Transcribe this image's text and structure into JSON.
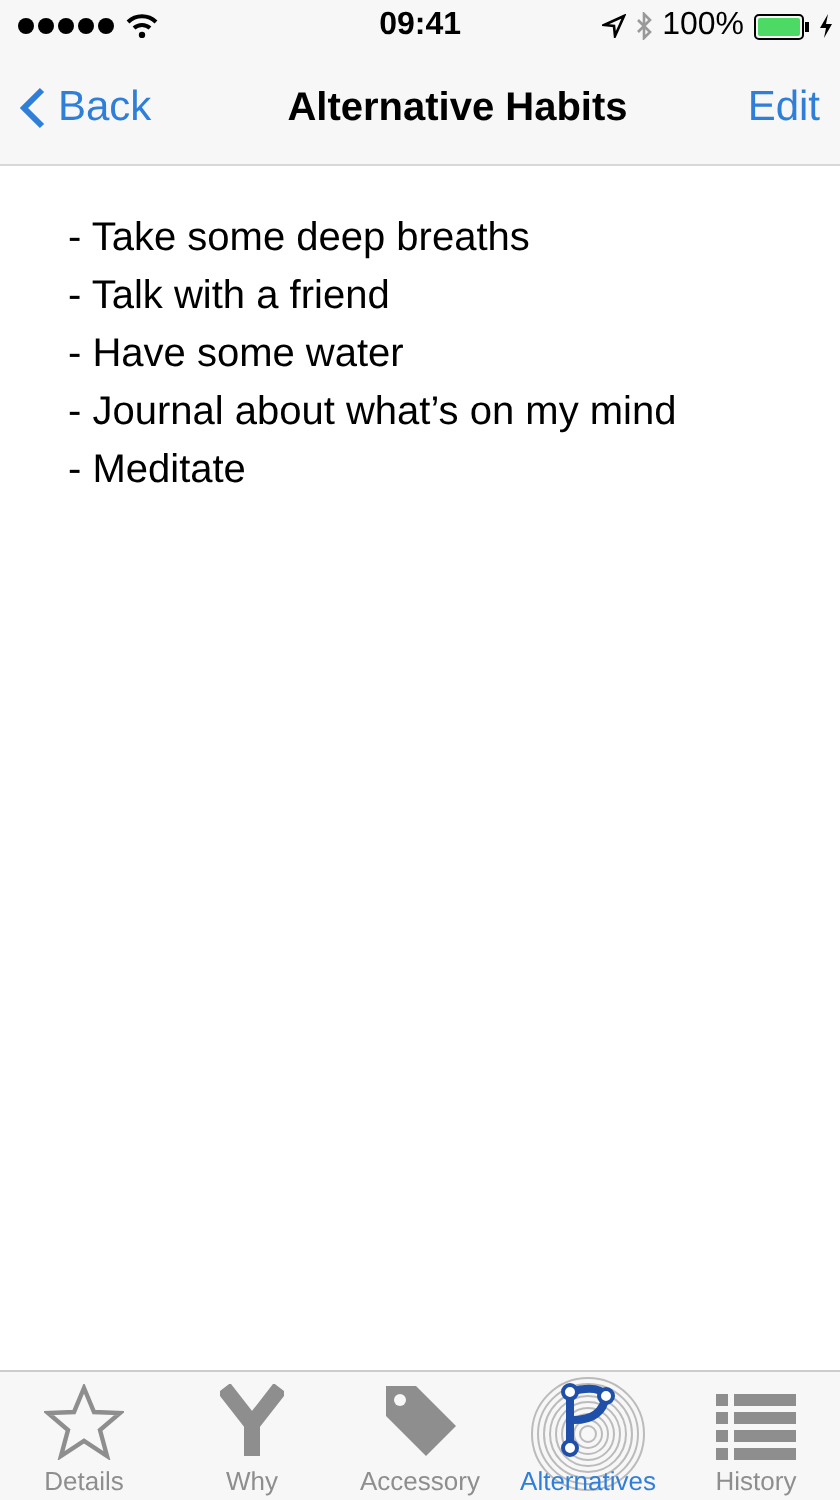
{
  "status_bar": {
    "time": "09:41",
    "battery_percent": "100%"
  },
  "nav_bar": {
    "back": "Back",
    "title": "Alternative Habits",
    "action": "Edit"
  },
  "note_lines": [
    "- Take some deep breaths",
    "- Talk with a friend",
    "- Have some water",
    "- Journal about what’s on my mind",
    "- Meditate"
  ],
  "tab_bar": [
    {
      "label": "Details",
      "kind": "star",
      "selected": false
    },
    {
      "label": "Why",
      "kind": "fork",
      "selected": false
    },
    {
      "label": "Accessory",
      "kind": "tag",
      "selected": false
    },
    {
      "label": "Alternatives",
      "kind": "branch",
      "selected": true
    },
    {
      "label": "History",
      "kind": "list",
      "selected": false
    }
  ]
}
